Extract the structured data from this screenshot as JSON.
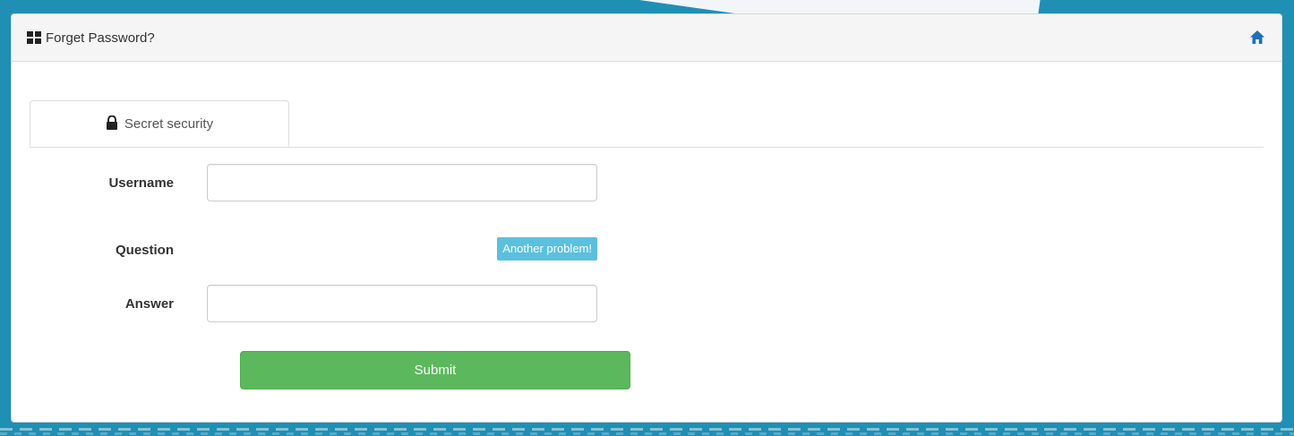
{
  "panel": {
    "title": "Forget Password?",
    "home_icon": "home-icon",
    "title_icon": "grid-icon"
  },
  "tabs": [
    {
      "label": "Secret security",
      "icon": "lock-icon",
      "active": true
    }
  ],
  "form": {
    "username": {
      "label": "Username",
      "value": "",
      "placeholder": ""
    },
    "question": {
      "label": "Question",
      "value": "",
      "help_link": "Another problem!"
    },
    "answer": {
      "label": "Answer",
      "value": "",
      "placeholder": ""
    },
    "submit_label": "Submit"
  },
  "colors": {
    "background": "#1f8fb4",
    "submit": "#5cb85c",
    "badge": "#5bc0de",
    "home_icon": "#1f6fb8"
  }
}
